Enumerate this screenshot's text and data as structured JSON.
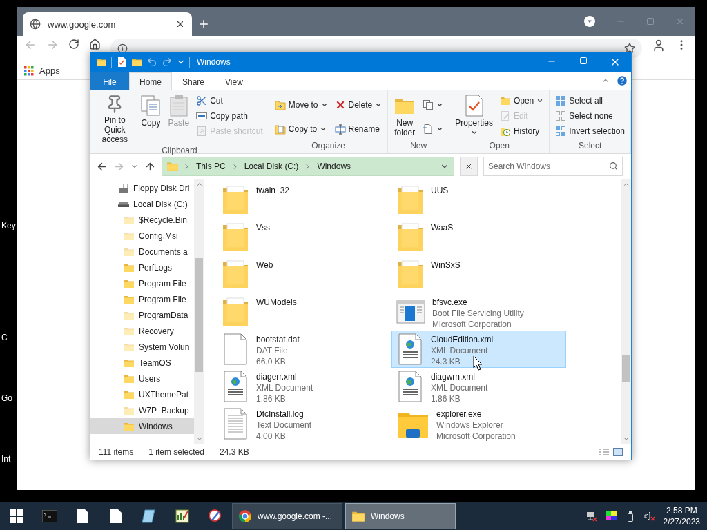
{
  "desktop": {
    "labels": [
      "Key",
      "C",
      "Go",
      "Int"
    ]
  },
  "browser": {
    "tab_title": "www.google.com",
    "bookmarks": [
      "Apps"
    ]
  },
  "explorer": {
    "title": "Windows",
    "ribbon_tabs": [
      {
        "label": "File",
        "kind": "file",
        "selected": false
      },
      {
        "label": "Home",
        "kind": "tab",
        "selected": true
      },
      {
        "label": "Share",
        "kind": "tab",
        "selected": false
      },
      {
        "label": "View",
        "kind": "tab",
        "selected": false
      }
    ],
    "ribbon_groups": [
      {
        "label": "Clipboard",
        "columns": [
          [
            {
              "label": "Pin to Quick\naccess",
              "kind": "large",
              "disabled": false
            }
          ],
          [
            {
              "label": "Copy",
              "kind": "large",
              "disabled": false
            }
          ],
          [
            {
              "label": "Paste",
              "kind": "large",
              "disabled": true
            }
          ],
          [
            {
              "label": "Cut",
              "kind": "small",
              "disabled": false
            },
            {
              "label": "Copy path",
              "kind": "small",
              "disabled": false
            },
            {
              "label": "Paste shortcut",
              "kind": "small",
              "disabled": true
            }
          ]
        ]
      },
      {
        "label": "Organize",
        "columns": [
          [
            {
              "label": "Move to",
              "kind": "small",
              "dropdown": true,
              "disabled": false
            },
            {
              "label": "Copy to",
              "kind": "small",
              "dropdown": true,
              "disabled": false
            }
          ],
          [
            {
              "label": "Delete",
              "kind": "small",
              "dropdown": true,
              "disabled": false
            },
            {
              "label": "Rename",
              "kind": "small",
              "dropdown": false,
              "disabled": false
            }
          ]
        ]
      },
      {
        "label": "New",
        "columns": [
          [
            {
              "label": "New\nfolder",
              "kind": "large",
              "disabled": false
            }
          ],
          [
            {
              "kind": "icon",
              "dropdown": true,
              "disabled": false
            },
            {
              "kind": "icon",
              "dropdown": true,
              "disabled": false
            }
          ]
        ]
      },
      {
        "label": "Open",
        "columns": [
          [
            {
              "label": "Properties",
              "kind": "large",
              "dropdown": true,
              "disabled": false
            }
          ],
          [
            {
              "label": "Open",
              "kind": "small",
              "dropdown": true,
              "disabled": false
            },
            {
              "label": "Edit",
              "kind": "small",
              "dropdown": false,
              "disabled": true
            },
            {
              "label": "History",
              "kind": "small",
              "dropdown": false,
              "disabled": false
            }
          ]
        ]
      },
      {
        "label": "Select",
        "columns": [
          [
            {
              "label": "Select all",
              "kind": "small",
              "disabled": false
            },
            {
              "label": "Select none",
              "kind": "small",
              "disabled": false
            },
            {
              "label": "Invert selection",
              "kind": "small",
              "disabled": false
            }
          ]
        ]
      }
    ],
    "breadcrumbs": [
      "This PC",
      "Local Disk (C:)",
      "Windows"
    ],
    "search": {
      "placeholder": "Search Windows"
    },
    "nav_tree": [
      {
        "label": "Floppy Disk Dri",
        "kind": "floppy",
        "selected": false
      },
      {
        "label": "Local Disk (C:)",
        "kind": "disk",
        "selected": false,
        "children": [
          {
            "label": "$Recycle.Bin",
            "kind": "folder",
            "hidden": true,
            "selected": false
          },
          {
            "label": "Config.Msi",
            "kind": "folder",
            "hidden": true,
            "selected": false
          },
          {
            "label": "Documents a",
            "kind": "folder",
            "hidden": true,
            "selected": false
          },
          {
            "label": "PerfLogs",
            "kind": "folder",
            "hidden": false,
            "selected": false
          },
          {
            "label": "Program File",
            "kind": "folder",
            "hidden": false,
            "selected": false
          },
          {
            "label": "Program File",
            "kind": "folder",
            "hidden": false,
            "selected": false
          },
          {
            "label": "ProgramData",
            "kind": "folder",
            "hidden": true,
            "selected": false
          },
          {
            "label": "Recovery",
            "kind": "folder",
            "hidden": true,
            "selected": false
          },
          {
            "label": "System Volun",
            "kind": "folder",
            "hidden": true,
            "selected": false
          },
          {
            "label": "TeamOS",
            "kind": "folder",
            "hidden": false,
            "selected": false
          },
          {
            "label": "Users",
            "kind": "folder",
            "hidden": false,
            "selected": false
          },
          {
            "label": "UXThemePat",
            "kind": "folder",
            "hidden": false,
            "selected": false
          },
          {
            "label": "W7P_Backup",
            "kind": "folder",
            "hidden": true,
            "selected": false
          },
          {
            "label": "Windows",
            "kind": "folder",
            "hidden": false,
            "selected": true
          }
        ]
      }
    ],
    "items": [
      {
        "name": "twain_32",
        "kind": "folder",
        "selected": false
      },
      {
        "name": "UUS",
        "kind": "folder",
        "selected": false
      },
      {
        "name": "Vss",
        "kind": "folder",
        "selected": false
      },
      {
        "name": "WaaS",
        "kind": "folder",
        "selected": false
      },
      {
        "name": "Web",
        "kind": "folder",
        "selected": false
      },
      {
        "name": "WinSxS",
        "kind": "folder",
        "selected": false
      },
      {
        "name": "WUModels",
        "kind": "folder",
        "selected": false
      },
      {
        "name": "bfsvc.exe",
        "kind": "exe",
        "details": [
          "Boot File Servicing Utility",
          "Microsoft Corporation"
        ],
        "selected": false
      },
      {
        "name": "bootstat.dat",
        "kind": "file",
        "details": [
          "DAT File",
          "66.0 KB"
        ],
        "selected": false
      },
      {
        "name": "CloudEdition.xml",
        "kind": "xml",
        "details": [
          "XML Document",
          "24.3 KB"
        ],
        "selected": true
      },
      {
        "name": "diagerr.xml",
        "kind": "xml",
        "details": [
          "XML Document",
          "1.86 KB"
        ],
        "selected": false
      },
      {
        "name": "diagwrn.xml",
        "kind": "xml",
        "details": [
          "XML Document",
          "1.86 KB"
        ],
        "selected": false
      },
      {
        "name": "DtcInstall.log",
        "kind": "log",
        "details": [
          "Text Document",
          "4.00 KB"
        ],
        "selected": false
      },
      {
        "name": "explorer.exe",
        "kind": "explorer",
        "details": [
          "Windows Explorer",
          "Microsoft Corporation"
        ],
        "selected": false
      }
    ],
    "status": {
      "count": "111 items",
      "selection": "1 item selected",
      "size": "24.3 KB"
    }
  },
  "taskbar": {
    "buttons": [
      {
        "label": "www.google.com -...",
        "kind": "chrome",
        "active": false
      },
      {
        "label": "Windows",
        "kind": "folder",
        "active": true
      }
    ],
    "clock": {
      "time": "2:58 PM",
      "date": "2/27/2023"
    }
  }
}
